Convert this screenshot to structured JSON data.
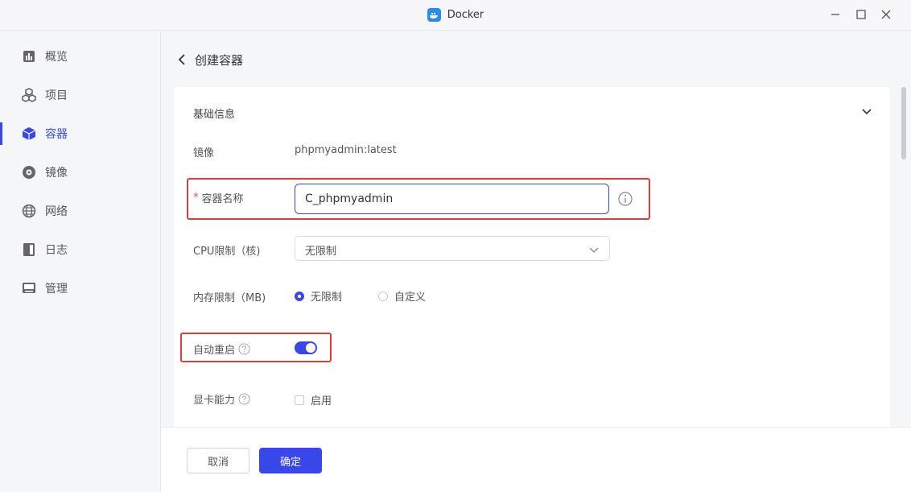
{
  "window": {
    "title": "Docker"
  },
  "sidebar": {
    "items": [
      {
        "label": "概览",
        "icon": "chart-icon"
      },
      {
        "label": "项目",
        "icon": "cubes-icon"
      },
      {
        "label": "容器",
        "icon": "cube-icon",
        "active": true
      },
      {
        "label": "镜像",
        "icon": "disc-icon"
      },
      {
        "label": "网络",
        "icon": "globe-icon"
      },
      {
        "label": "日志",
        "icon": "book-icon"
      },
      {
        "label": "管理",
        "icon": "monitor-icon"
      }
    ]
  },
  "header": {
    "title": "创建容器"
  },
  "section": {
    "title": "基础信息"
  },
  "form": {
    "image_label": "镜像",
    "image_value": "phpmyadmin:latest",
    "name_required": "*",
    "name_label": "容器名称",
    "name_value": "C_phpmyadmin",
    "cpu_label": "CPU限制（核)",
    "cpu_value": "无限制",
    "memory_label": "内存限制（MB)",
    "memory_options": [
      "无限制",
      "自定义"
    ],
    "memory_selected": "无限制",
    "restart_label": "自动重启",
    "restart_enabled": true,
    "gpu_label": "显卡能力",
    "gpu_option": "启用",
    "gpu_enabled": false
  },
  "footer": {
    "cancel_label": "取消",
    "confirm_label": "确定"
  },
  "colors": {
    "accent": "#3a47e8",
    "highlight": "#e53935",
    "required": "#e5484d"
  }
}
